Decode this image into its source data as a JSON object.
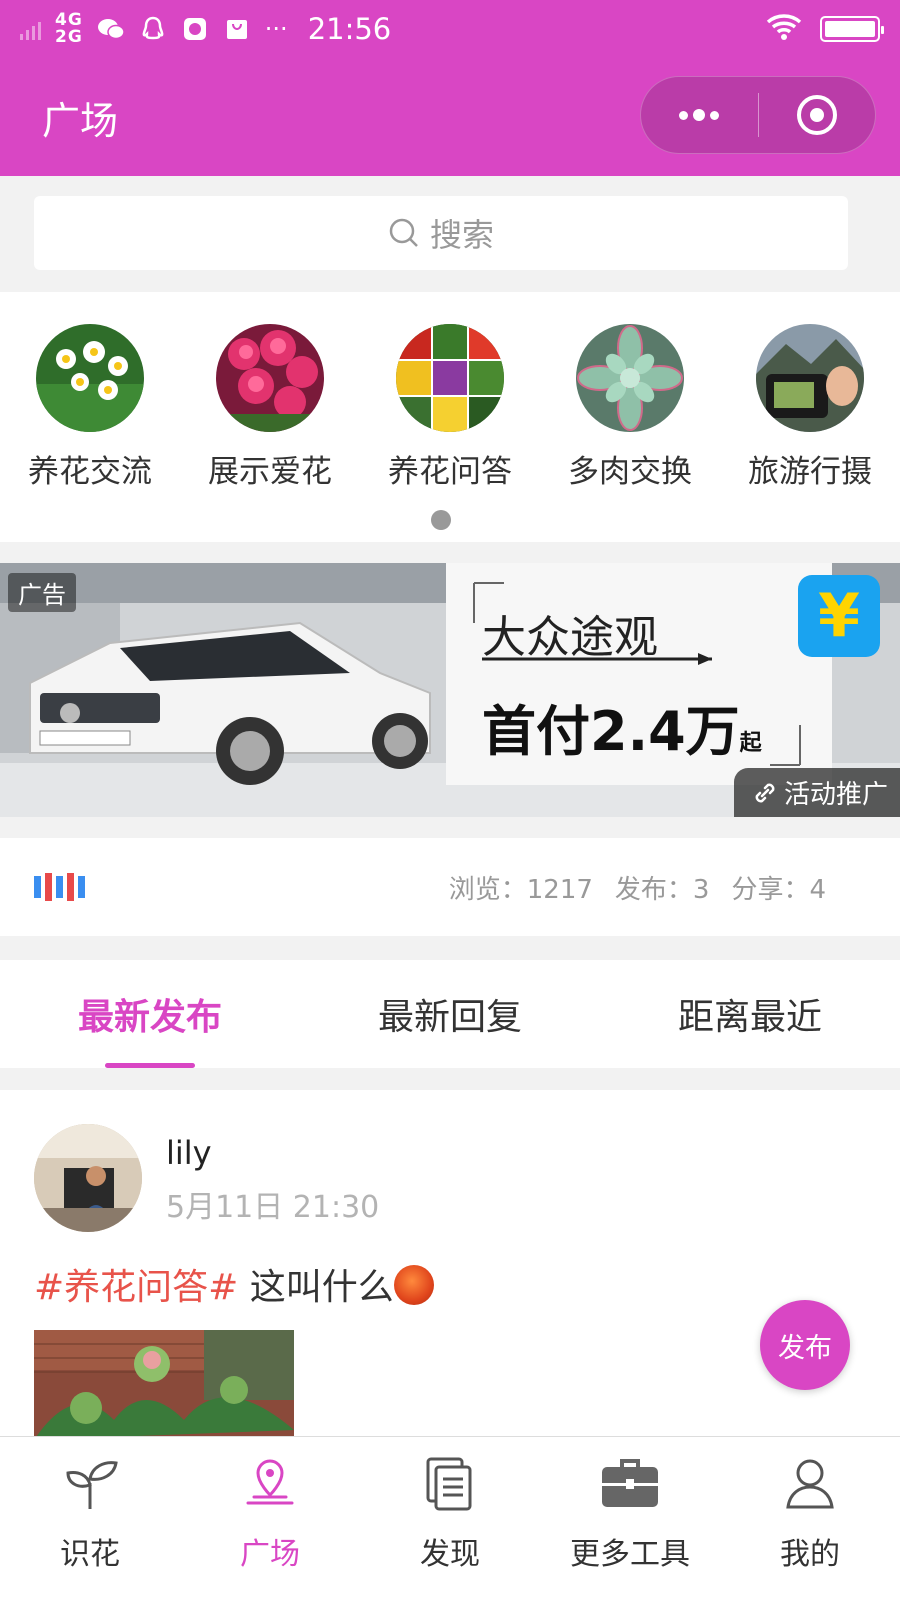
{
  "status_bar": {
    "network_top": "4G",
    "network_bottom": "2G",
    "more": "···",
    "time": "21:56"
  },
  "nav": {
    "title": "广场"
  },
  "search": {
    "placeholder": "搜索"
  },
  "categories": [
    {
      "label": "养花交流",
      "icon": "narcissus-photo"
    },
    {
      "label": "展示爱花",
      "icon": "pink-flowers-photo"
    },
    {
      "label": "养花问答",
      "icon": "flower-grid-photo"
    },
    {
      "label": "多肉交换",
      "icon": "succulent-photo"
    },
    {
      "label": "旅游行摄",
      "icon": "camera-photo"
    }
  ],
  "ad": {
    "label": "广告",
    "headline": "大众途观",
    "subline": "首付2.4万",
    "subline_suffix": "起",
    "badge": "¥",
    "promo": "活动推广"
  },
  "stats": {
    "views": "浏览：1217",
    "posts": "发布：3",
    "shares": "分享：4"
  },
  "tabs": [
    {
      "label": "最新发布",
      "active": true
    },
    {
      "label": "最新回复",
      "active": false
    },
    {
      "label": "距离最近",
      "active": false
    }
  ],
  "post": {
    "user": "lily",
    "time": "5月11日 21:30",
    "tag": "#养花问答#",
    "text": "这叫什么"
  },
  "fab": {
    "label": "发布"
  },
  "tabbar": [
    {
      "label": "识花",
      "icon": "sprout-icon",
      "active": false
    },
    {
      "label": "广场",
      "icon": "location-pin-icon",
      "active": true
    },
    {
      "label": "发现",
      "icon": "document-stack-icon",
      "active": false
    },
    {
      "label": "更多工具",
      "icon": "toolbox-icon",
      "active": false
    },
    {
      "label": "我的",
      "icon": "user-icon",
      "active": false
    }
  ],
  "colors": {
    "accent": "#d946c4",
    "tag": "#e8534a"
  }
}
